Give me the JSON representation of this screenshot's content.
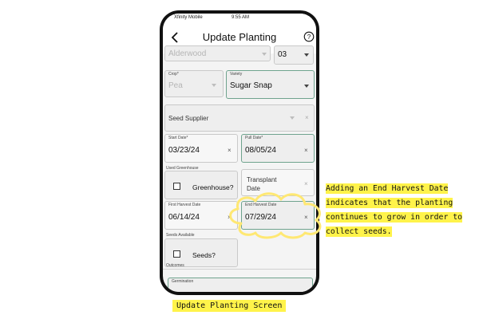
{
  "status_bar": {
    "carrier": "Xfinity Mobile",
    "time": "9:55 AM"
  },
  "header": {
    "title": "Update Planting",
    "back_icon": "chevron-left-icon",
    "help_icon": "help-circle-icon"
  },
  "form": {
    "location": {
      "value": "Alderwood"
    },
    "bed": {
      "value": "03"
    },
    "crop": {
      "label": "Crop*",
      "value": "Pea"
    },
    "variety": {
      "label": "Variety",
      "value": "Sugar Snap"
    },
    "seed_supplier": {
      "placeholder": "Seed Supplier"
    },
    "start_date": {
      "label": "Start Date*",
      "value": "03/23/24"
    },
    "pull_date": {
      "label": "Pull Date*",
      "value": "08/05/24"
    },
    "used_greenhouse": {
      "label": "Used Greenhouse",
      "checkbox_label": "Greenhouse?"
    },
    "transplant_date": {
      "placeholder": "Transplant Date"
    },
    "first_harvest_date": {
      "label": "First Harvest Date",
      "value": "06/14/24"
    },
    "end_harvest_date": {
      "label": "End Harvest Date",
      "value": "07/29/24"
    },
    "seeds_available": {
      "label": "Seeds Available",
      "checkbox_label": "Seeds?"
    },
    "outcomes": {
      "label": "Outcomes"
    },
    "germination": {
      "label": "Germination"
    },
    "clear_symbol": "×"
  },
  "annotation": {
    "callout_text": "Adding an End Harvest Date indicates that the planting continues to grow in order to collect seeds.",
    "caption": "Update Planting Screen",
    "highlight_color": "#fff34a",
    "cloud_color": "#ffe873"
  }
}
